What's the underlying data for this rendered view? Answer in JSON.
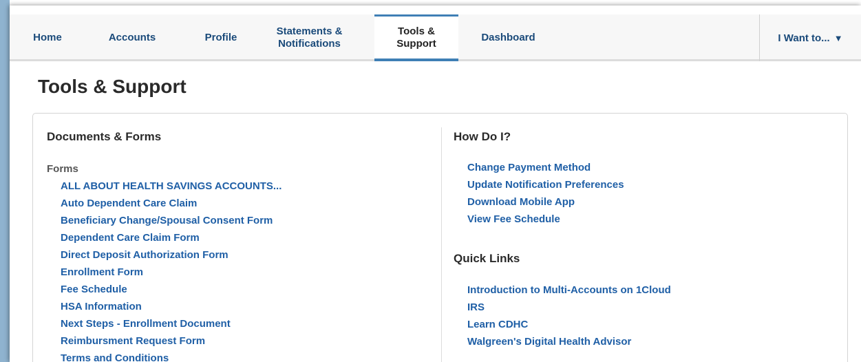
{
  "nav": {
    "items": [
      {
        "label": "Home"
      },
      {
        "label": "Accounts"
      },
      {
        "label": "Profile"
      },
      {
        "label": "Statements &\nNotifications"
      },
      {
        "label": "Tools &\nSupport"
      },
      {
        "label": "Dashboard"
      }
    ],
    "active_index": 4,
    "i_want_label": "I Want to...",
    "i_want_icon": "caret-down-icon"
  },
  "page": {
    "title": "Tools & Support"
  },
  "documents": {
    "heading": "Documents & Forms",
    "forms_label": "Forms",
    "links": [
      "ALL ABOUT HEALTH SAVINGS ACCOUNTS...",
      "Auto Dependent Care Claim",
      "Beneficiary Change/Spousal Consent Form",
      "Dependent Care Claim Form",
      "Direct Deposit Authorization Form",
      "Enrollment Form",
      "Fee Schedule",
      "HSA Information",
      "Next Steps - Enrollment Document",
      "Reimbursment Request Form",
      "Terms and Conditions"
    ]
  },
  "how_do_i": {
    "heading": "How Do I?",
    "links": [
      "Change Payment Method",
      "Update Notification Preferences",
      "Download Mobile App",
      "View Fee Schedule"
    ]
  },
  "quick_links": {
    "heading": "Quick Links",
    "links": [
      "Introduction to Multi-Accounts on 1Cloud",
      "IRS",
      "Learn CDHC",
      "Walgreen's Digital Health Advisor"
    ]
  },
  "colors": {
    "link": "#1f5fa6",
    "nav_text": "#1a4a7a",
    "active_tab_border": "#3f7fb5",
    "frame": "#8fb3cf"
  }
}
